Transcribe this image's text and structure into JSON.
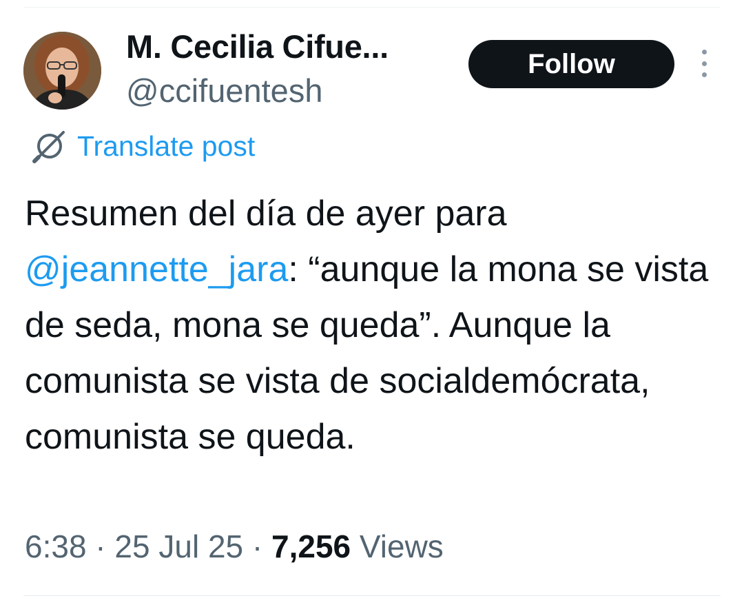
{
  "author": {
    "display_name": "M. Cecilia Cifue...",
    "handle": "@ccifuentesh",
    "avatar_icon": "profile-photo"
  },
  "actions": {
    "follow_label": "Follow",
    "more_icon": "more-vertical-icon"
  },
  "translate": {
    "label": "Translate post",
    "icon": "globe-icon"
  },
  "tweet": {
    "text_before_mention": "Resumen del día de ayer para ",
    "mention": "@jeannette_jara",
    "text_after_mention": ": “aunque la mona se vista de seda, mona se queda”. Aunque la comunista se vista de socialdemócrata, comunista se queda."
  },
  "meta": {
    "time": "6:38",
    "separator": " · ",
    "date": "25 Jul 25",
    "views_count": "7,256",
    "views_label": "Views"
  },
  "colors": {
    "link": "#1d9bf0",
    "text": "#0f1419",
    "muted": "#536471",
    "button_bg": "#0f1419"
  }
}
